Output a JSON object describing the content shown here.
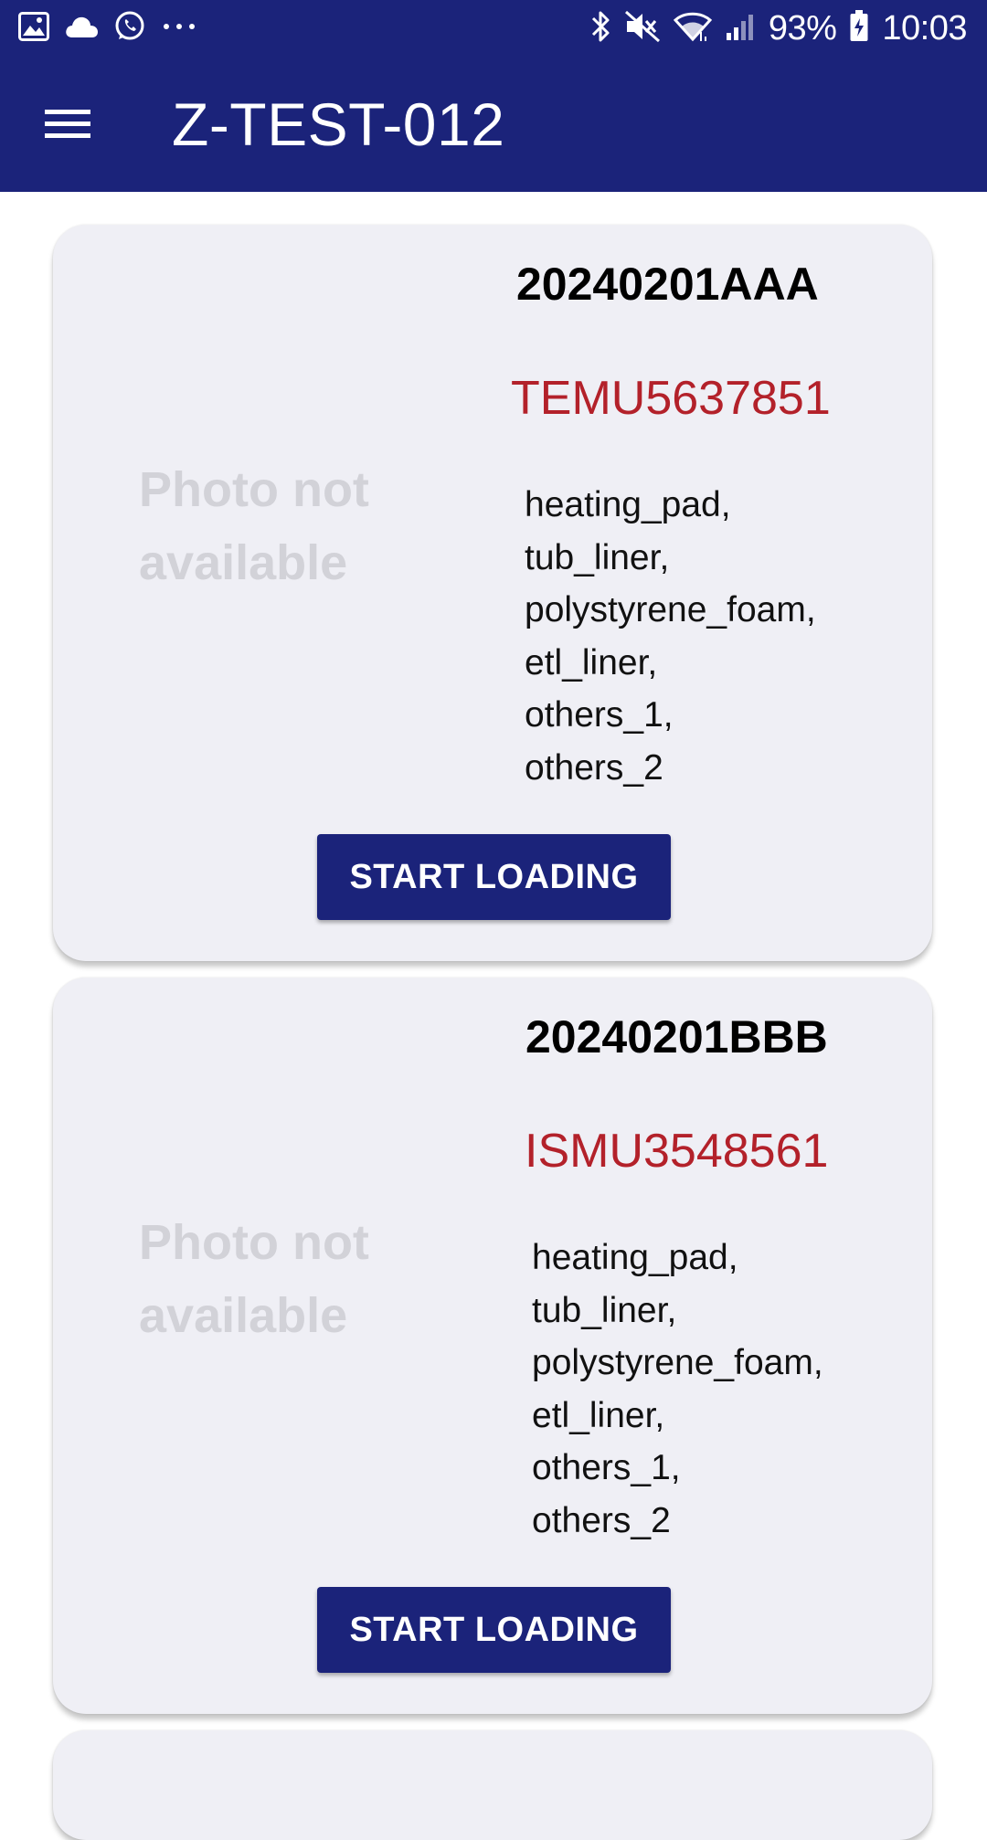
{
  "status_bar": {
    "battery": "93%",
    "time": "10:03",
    "left_icons": [
      "gallery-icon",
      "cloud-icon",
      "whatsapp-icon",
      "more-dots-icon"
    ],
    "right_icons": [
      "bluetooth-icon",
      "mute-icon",
      "wifi-icon",
      "signal-icon",
      "battery-icon"
    ]
  },
  "app_bar": {
    "title": "Z-TEST-012",
    "menu_icon": "hamburger-menu-icon"
  },
  "cards": [
    {
      "photo_placeholder": [
        "Photo not",
        "available"
      ],
      "batch_id": "20240201AAA",
      "container_no": "TEMU5637851",
      "materials": [
        "heating_pad,",
        "tub_liner,",
        "polystyrene_foam,",
        "etl_liner,",
        "others_1,",
        "others_2"
      ],
      "button_label": "START LOADING"
    },
    {
      "photo_placeholder": [
        "Photo not",
        "available"
      ],
      "batch_id": "20240201BBB",
      "container_no": "ISMU3548561",
      "materials": [
        "heating_pad,",
        "tub_liner,",
        "polystyrene_foam,",
        "etl_liner,",
        "others_1,",
        "others_2"
      ],
      "button_label": "START LOADING"
    }
  ],
  "colors": {
    "primary": "#1b237a",
    "container_text": "#b3212a",
    "card_bg": "#efeff5",
    "placeholder_text": "#d2d2d8"
  }
}
